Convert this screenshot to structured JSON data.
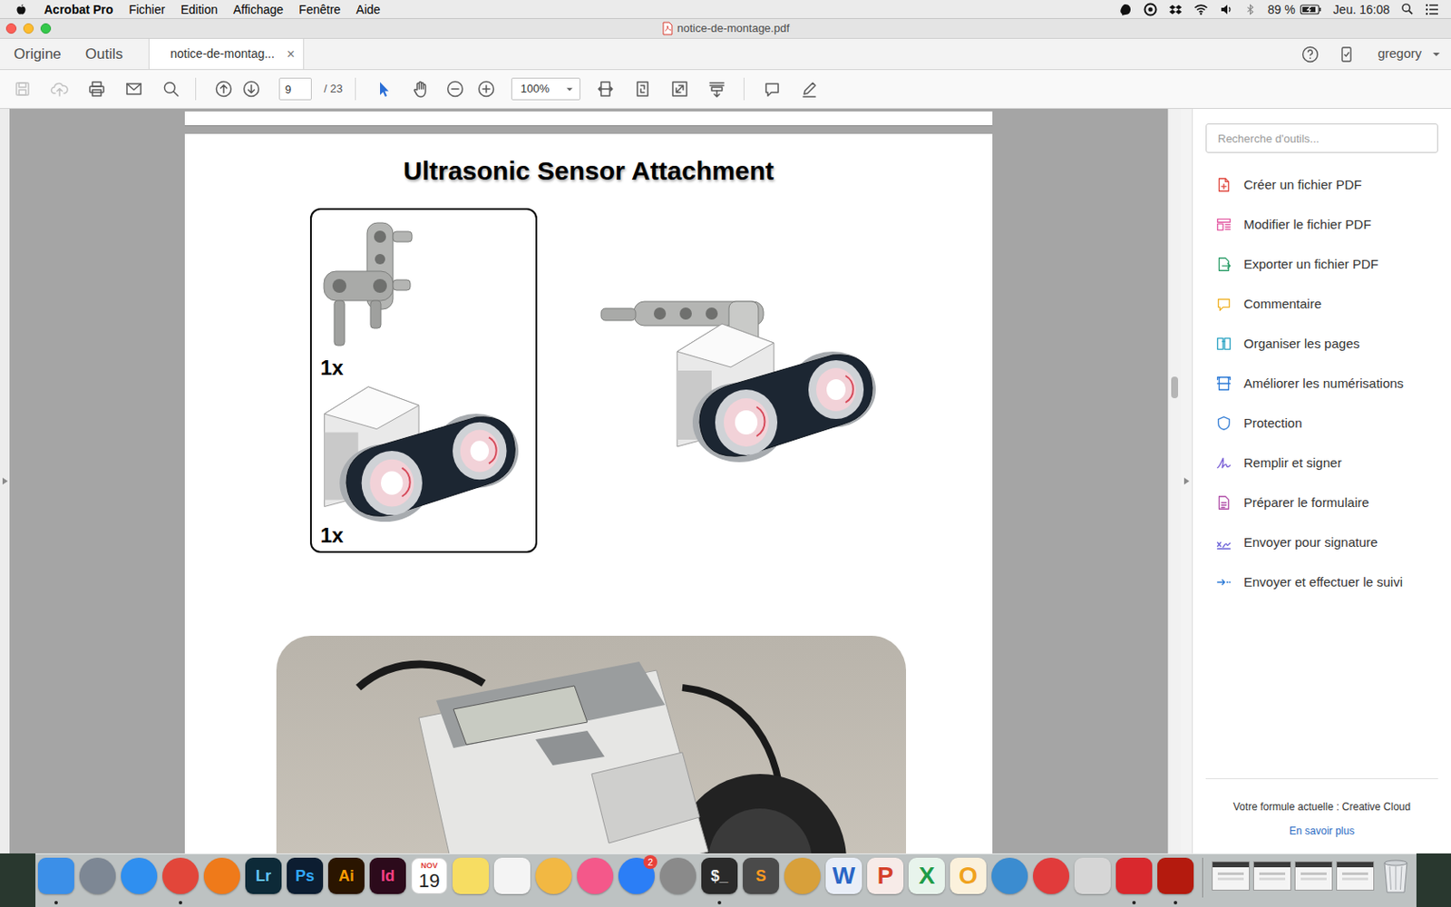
{
  "menubar": {
    "app": "Acrobat Pro",
    "items": [
      "Fichier",
      "Edition",
      "Affichage",
      "Fenêtre",
      "Aide"
    ],
    "battery": "89 %",
    "clock": "Jeu. 16:08"
  },
  "window": {
    "title": "notice-de-montage.pdf"
  },
  "nav": [
    "Origine",
    "Outils"
  ],
  "tabs": [
    {
      "label": "notice-de-montag...",
      "close": "×",
      "selected": true
    }
  ],
  "user": {
    "name": "gregory"
  },
  "toolbar": {
    "left": [
      {
        "kind": "save",
        "disabled": true
      },
      {
        "kind": "upload",
        "disabled": true
      },
      {
        "kind": "print",
        "disabled": false
      },
      {
        "kind": "mail",
        "disabled": false
      },
      {
        "kind": "search",
        "disabled": false
      }
    ],
    "pager": [
      {
        "kind": "prev"
      },
      {
        "kind": "next"
      }
    ],
    "page": "9",
    "page_total": "/ 23",
    "modes": [
      {
        "kind": "select",
        "selected": true
      },
      {
        "kind": "hand",
        "selected": false
      }
    ],
    "zoom_buttons": [
      {
        "kind": "zoomout"
      },
      {
        "kind": "zoomin"
      }
    ],
    "zoom": "100%",
    "view": [
      {
        "kind": "fitwidth"
      },
      {
        "kind": "fitpage"
      },
      {
        "kind": "fullscreen"
      },
      {
        "kind": "scroll"
      }
    ],
    "annotate": [
      {
        "kind": "comment"
      },
      {
        "kind": "pen"
      }
    ]
  },
  "document": {
    "title": "Ultrasonic Sensor Attachment",
    "parts": [
      {
        "count": "1x",
        "kind": "connector"
      },
      {
        "count": "1x",
        "kind": "sensor"
      }
    ]
  },
  "scrollbar": {
    "level": 0.37
  },
  "tools_panel": {
    "search_placeholder": "Recherche d'outils...",
    "tools": [
      {
        "label": "Créer un fichier PDF",
        "kind": "create",
        "color": "#e0483f"
      },
      {
        "label": "Modifier le fichier PDF",
        "kind": "edit",
        "color": "#e35ba3"
      },
      {
        "label": "Exporter un fichier PDF",
        "kind": "export",
        "color": "#2e9e6a"
      },
      {
        "label": "Commentaire",
        "kind": "comment",
        "color": "#f0b32a"
      },
      {
        "label": "Organiser les pages",
        "kind": "organize",
        "color": "#2fa5c4"
      },
      {
        "label": "Améliorer les numérisations",
        "kind": "enhance",
        "color": "#2c7ad6"
      },
      {
        "label": "Protection",
        "kind": "protect",
        "color": "#3b82d6"
      },
      {
        "label": "Remplir et signer",
        "kind": "sign",
        "color": "#7a5fd6"
      },
      {
        "label": "Préparer le formulaire",
        "kind": "form",
        "color": "#b04fa8"
      },
      {
        "label": "Envoyer pour signature",
        "kind": "sendsign",
        "color": "#6c63d8"
      },
      {
        "label": "Envoyer et effectuer le suivi",
        "kind": "track",
        "color": "#2c7ad6"
      }
    ],
    "plan": "Votre formule actuelle : Creative Cloud",
    "link": "En savoir plus"
  },
  "dock": {
    "apps": [
      {
        "kind": "tile",
        "color": "#3b8fe8",
        "running": true
      },
      {
        "kind": "circle",
        "color": "#7d8794",
        "running": false
      },
      {
        "kind": "circle",
        "color": "#2f8ff0",
        "running": false
      },
      {
        "kind": "circle",
        "color": "#e2463a",
        "running": true
      },
      {
        "kind": "circle",
        "color": "#ef7a1a",
        "running": false
      },
      {
        "kind": "tile",
        "color": "#0d2a38",
        "ink": "#62c3ff",
        "text": "Lr",
        "running": false
      },
      {
        "kind": "tile",
        "color": "#0c1d31",
        "ink": "#31a8ff",
        "text": "Ps",
        "running": false
      },
      {
        "kind": "tile",
        "color": "#2a1500",
        "ink": "#ff9a00",
        "text": "Ai",
        "running": false
      },
      {
        "kind": "tile",
        "color": "#2c0a1b",
        "ink": "#ff3f84",
        "text": "Id",
        "running": false
      },
      {
        "kind": "calendar",
        "month": "NOV",
        "day": "19",
        "running": false
      },
      {
        "kind": "tile",
        "color": "#f7dd62",
        "running": false
      },
      {
        "kind": "tile",
        "color": "#f4f4f4",
        "running": false
      },
      {
        "kind": "circle",
        "color": "#f2b843",
        "running": false
      },
      {
        "kind": "circle",
        "color": "#f4588a",
        "running": false
      },
      {
        "kind": "circle",
        "color": "#2b7ef6",
        "badge": "2",
        "running": false
      },
      {
        "kind": "circle",
        "color": "#8a8a8a",
        "running": false
      },
      {
        "kind": "tile",
        "color": "#2a2a2a",
        "ink": "#f0f0f0",
        "text": "$_",
        "running": true
      },
      {
        "kind": "tile",
        "color": "#4a4a4a",
        "ink": "#ff9a1f",
        "text": "S",
        "running": false
      },
      {
        "kind": "circle",
        "color": "#d8a03a",
        "running": false
      },
      {
        "kind": "tile",
        "color": "#e9eef7",
        "ink": "#2a66c6",
        "text": "W",
        "running": false
      },
      {
        "kind": "tile",
        "color": "#f7ebe8",
        "ink": "#d5402a",
        "text": "P",
        "running": false
      },
      {
        "kind": "tile",
        "color": "#e8f4ec",
        "ink": "#1f9c48",
        "text": "X",
        "running": false
      },
      {
        "kind": "tile",
        "color": "#fbf1dc",
        "ink": "#f0a21e",
        "text": "O",
        "running": false
      },
      {
        "kind": "circle",
        "color": "#3b8cd0",
        "running": false
      },
      {
        "kind": "circle",
        "color": "#e13b3b",
        "running": false
      },
      {
        "kind": "tile",
        "color": "#d6d6d6",
        "running": false
      },
      {
        "kind": "tile",
        "color": "#d9282d",
        "running": true
      },
      {
        "kind": "tile",
        "color": "#b41a0e",
        "running": true
      }
    ]
  }
}
